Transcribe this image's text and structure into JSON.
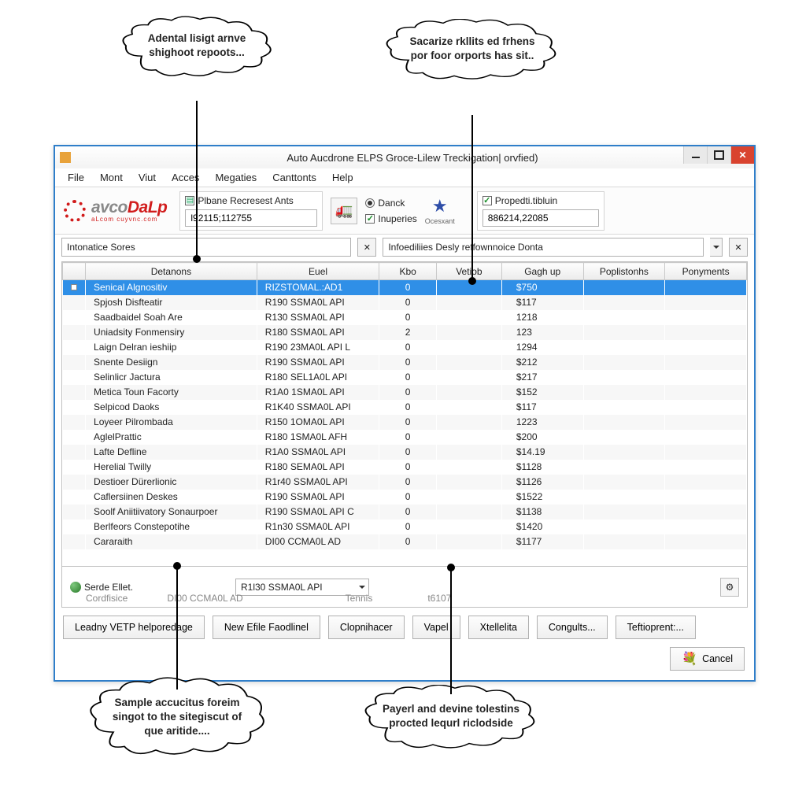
{
  "callouts": {
    "top_left": "Adental lisigt arnve shighoot repoots...",
    "top_right": "Sacarize rkllits ed frhens por foor orports has sit..",
    "bottom_left": "Sample accucitus foreim singot to the sitegiscut of que aritide....",
    "bottom_right": "Payerl and devine tolestins procted lequrl riclodside"
  },
  "window": {
    "title": "Auto Aucdrone ELPS Groce-Lilew Treckigation| orvfied)"
  },
  "menu": [
    "File",
    "Mont",
    "Viut",
    "Acces",
    "Megaties",
    "Canttonts",
    "Help"
  ],
  "toolbar": {
    "logo_main_a": "avco",
    "logo_main_b": "DaLp",
    "logo_sub": "aLcom cuyvnc.com",
    "group1_label": "Plbane Recresest Ants",
    "group1_value": "l92115;112755",
    "radio1": "Danck",
    "check1": "Inuperies",
    "star_label": "Ocesxant",
    "group3_label": "Propedti.tibluin",
    "group3_value": "886214,22085"
  },
  "search": {
    "left_value": "Intonatice Sores",
    "right_value": "Infoediliies Desly reffownnoice Donta"
  },
  "table": {
    "headers": [
      "",
      "Detanons",
      "Euel",
      "Kbo",
      "Vetiob",
      "Gagh up",
      "Poplistonhs",
      "Ponyments"
    ],
    "rows": [
      {
        "sel": true,
        "name": "Senical Algnositiv",
        "euel": "RIZSTOMAL.:AD1",
        "kbo": "0",
        "vet": "",
        "gag": "$750",
        "pop": "",
        "pon": ""
      },
      {
        "name": "Spjosh Disfteatir",
        "euel": "R190 SSMA0L API",
        "kbo": "0",
        "vet": "",
        "gag": "$117"
      },
      {
        "name": "Saadbaidel Soah Are",
        "euel": "R130 SSMA0L API",
        "kbo": "0",
        "vet": "",
        "gag": "1218"
      },
      {
        "name": "Uniadsity Fonmensiry",
        "euel": "R180 SSMA0L API",
        "kbo": "2",
        "vet": "",
        "gag": "123"
      },
      {
        "name": "Laign Delran ieshiip",
        "euel": "R190 23MA0L API L",
        "kbo": "0",
        "vet": "",
        "gag": "1294"
      },
      {
        "name": "Snente Desiign",
        "euel": "R190 SSMA0L API",
        "kbo": "0",
        "vet": "",
        "gag": "$212"
      },
      {
        "name": "Selinlicr Jactura",
        "euel": "R180 SEL1A0L API",
        "kbo": "0",
        "vet": "",
        "gag": "$217"
      },
      {
        "name": "Metica Toun Facorty",
        "euel": "R1A0 1SMA0L API",
        "kbo": "0",
        "vet": "",
        "gag": "$152"
      },
      {
        "name": "Selpicod Daoks",
        "euel": "R1K40 SSMA0L API",
        "kbo": "0",
        "vet": "",
        "gag": "$117"
      },
      {
        "name": "Loyeer Pilrombada",
        "euel": "R150 1OMA0L API",
        "kbo": "0",
        "vet": "",
        "gag": "1223"
      },
      {
        "name": "AglelPrattic",
        "euel": "R180 1SMA0L AFH",
        "kbo": "0",
        "vet": "",
        "gag": "$200"
      },
      {
        "name": "Lafte Defline",
        "euel": "R1A0 SSMA0L API",
        "kbo": "0",
        "vet": "",
        "gag": "$14.19"
      },
      {
        "name": "Herelial Twilly",
        "euel": "R180 SEMA0L API",
        "kbo": "0",
        "vet": "",
        "gag": "$1128"
      },
      {
        "name": "Destioer Dürerlionic",
        "euel": "R1r40 SSMA0L API",
        "kbo": "0",
        "vet": "",
        "gag": "$1126"
      },
      {
        "name": "Caflersiinen Deskes",
        "euel": "R190 SSMA0L API",
        "kbo": "0",
        "vet": "",
        "gag": "$1522"
      },
      {
        "name": "Soolf Aniitiivatory Sonaurpoer",
        "euel": "R190 SSMA0L API C",
        "kbo": "0",
        "vet": "",
        "gag": "$1138"
      },
      {
        "name": "Berlfeors Constepotihe",
        "euel": "R1n30 SSMA0L API",
        "kbo": "0",
        "vet": "",
        "gag": "$1420"
      },
      {
        "name": "Cararaith",
        "euel": "DI00 CCMA0L AD",
        "kbo": "0",
        "vet": "",
        "gag": "$1177"
      }
    ]
  },
  "subrow": {
    "label1": "Serde Ellet.",
    "combo1": "R1l30 SSMA0L API",
    "fade_name": "Cordfisice",
    "fade_euel": "DI00 CCMA0L AD",
    "fade_mid": "Tennis",
    "fade_gag": "t6107"
  },
  "buttons": {
    "b1": "Leadny VETP helporedage",
    "b2": "New Efile Faodlinel",
    "b3": "Clopnihacer",
    "b4": "Vapel",
    "b5": "Xtellelita",
    "b6": "Congults...",
    "b7": "Teftioprent:...",
    "cancel": "Cancel"
  }
}
